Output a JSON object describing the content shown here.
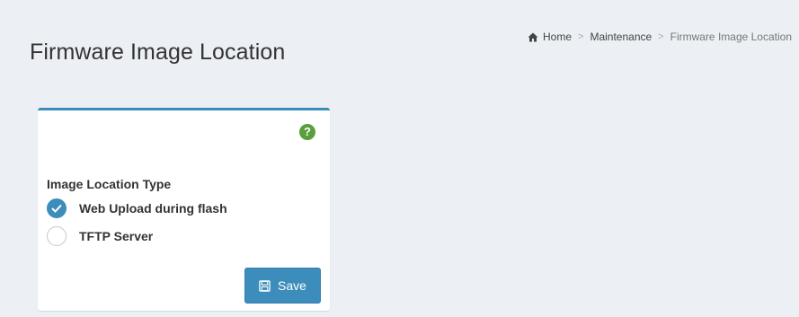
{
  "page": {
    "title": "Firmware Image Location"
  },
  "breadcrumb": {
    "home_icon": "home-icon",
    "items": [
      "Home",
      "Maintenance",
      "Firmware Image Location"
    ],
    "separator": ">"
  },
  "form": {
    "help_icon": "question-circle-icon",
    "help_glyph": "?",
    "field_label": "Image Location Type",
    "options": [
      {
        "label": "Web Upload during flash",
        "selected": true
      },
      {
        "label": "TFTP Server",
        "selected": false
      }
    ],
    "save_label": "Save",
    "save_icon": "floppy-disk-icon"
  },
  "colors": {
    "accent": "#3c8dbc",
    "help": "#5a9f3d",
    "background": "#ecf0f5"
  }
}
